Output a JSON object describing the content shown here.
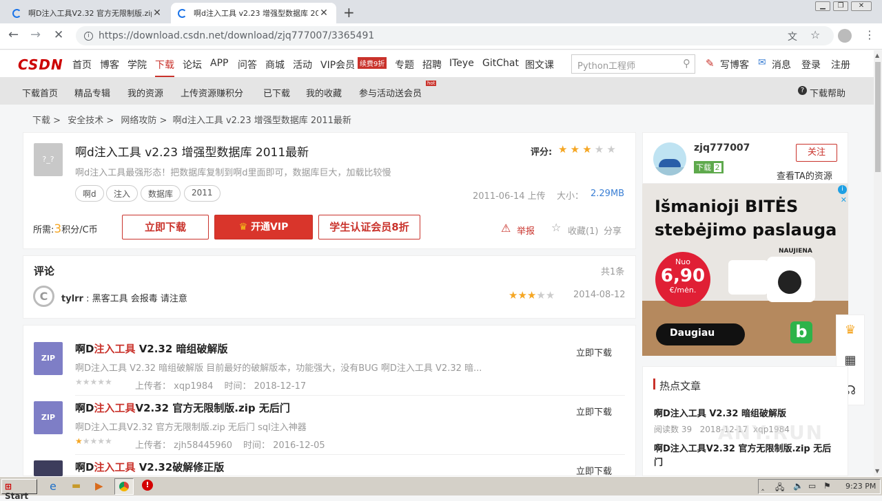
{
  "browser": {
    "tabs": [
      {
        "title": "啊D注入工具V2.32 官方无限制版.zip"
      },
      {
        "title": "啊d注入工具 v2.23 增强型数据库 2011"
      }
    ],
    "url": "https://download.csdn.net/download/zjq777007/3365491"
  },
  "header": {
    "logo": "CSDN",
    "nav": [
      "首页",
      "博客",
      "学院",
      "下载",
      "论坛",
      "APP",
      "问答",
      "商城",
      "活动",
      "VIP会员",
      "专题",
      "招聘",
      "ITeye",
      "GitChat",
      "图文课"
    ],
    "vip_badge": "续费9折",
    "search_placeholder": "Python工程师",
    "actions": [
      "写博客",
      "消息",
      "登录",
      "注册"
    ]
  },
  "subnav": {
    "items": [
      "下载首页",
      "精品专辑",
      "我的资源",
      "上传资源赚积分",
      "已下载",
      "我的收藏",
      "参与活动送会员"
    ],
    "hot_badge": "hot",
    "help": "下载帮助"
  },
  "breadcrumb": [
    "下载",
    "安全技术",
    "网络攻防",
    "啊d注入工具 v2.23 增强型数据库 2011最新"
  ],
  "resource": {
    "icon_text": "?_?",
    "title": "啊d注入工具 v2.23 增强型数据库 2011最新",
    "subtitle": "啊d注入工具最强形态！把数据库复制到啊d里面即可，数据库巨大，加载比较慢",
    "rating_label": "评分:",
    "rating": 3,
    "tags": [
      "啊d",
      "注入",
      "数据库",
      "2011"
    ],
    "upload_date": "2011-06-14 上传",
    "size_label": "大小：",
    "size": "2.29MB",
    "cost_prefix": "所需:",
    "cost_value": "3",
    "cost_suffix": "积分/C币",
    "btn_download": "立即下载",
    "btn_vip": "开通VIP",
    "btn_student": "学生认证会员8折",
    "report": "举报",
    "collect": "收藏(1)",
    "share": "分享"
  },
  "comments": {
    "title": "评论",
    "count": "共1条",
    "items": [
      {
        "user": "tylrr",
        "text": "黑客工具 会报毒 请注意",
        "rating": 3,
        "date": "2014-08-12"
      }
    ]
  },
  "related": {
    "uploader_label": "上传者：",
    "time_label": "时间：",
    "download_label": "立即下载",
    "items": [
      {
        "pre": "啊D",
        "hl": "注入工具",
        "post": " V2.32 暗组破解版",
        "icon": "ZIP",
        "desc": "啊D注入工具 V2.32 暗组破解版 目前最好的破解版本，功能强大，没有BUG 啊D注入工具 V2.32 暗...",
        "rating": 0,
        "uploader": "xqp1984",
        "time": "2018-12-17"
      },
      {
        "pre": "啊D",
        "hl": "注入工具",
        "post": "V2.32 官方无限制版.zip 无后门",
        "icon": "ZIP",
        "desc": "啊D注入工具V2.32 官方无限制版.zip 无后门 sql注入神器",
        "rating": 1,
        "uploader": "zjh58445960",
        "time": "2016-12-05"
      },
      {
        "pre": "啊D",
        "hl": "注入工具",
        "post": " V2.32破解修正版",
        "icon": "",
        "desc": "",
        "rating": 0,
        "uploader": "",
        "time": ""
      }
    ]
  },
  "author": {
    "name": "zjq777007",
    "badge": "下载",
    "level": "2",
    "follow": "关注",
    "view_resources": "查看TA的资源"
  },
  "ad": {
    "headline": "Išmanioji BITĖS stebėjimo paslauga",
    "badge_top": "Nuo",
    "price": "6,90",
    "unit": "€/mėn.",
    "tag": "NAUJIENA",
    "cta": "Daugiau",
    "brand": "b"
  },
  "hot": {
    "title": "热点文章",
    "items": [
      {
        "title": "啊D注入工具 V2.32 暗组破解版",
        "views_label": "阅读数",
        "views": "39",
        "date": "2018-12-17",
        "user": "xqp1984"
      },
      {
        "title": "啊D注入工具V2.32 官方无限制版.zip 无后门",
        "views_label": "",
        "views": "",
        "date": "",
        "user": ""
      }
    ]
  },
  "taskbar": {
    "start": "Start",
    "time": "9:23 PM"
  },
  "watermark": "ANY.RUN"
}
